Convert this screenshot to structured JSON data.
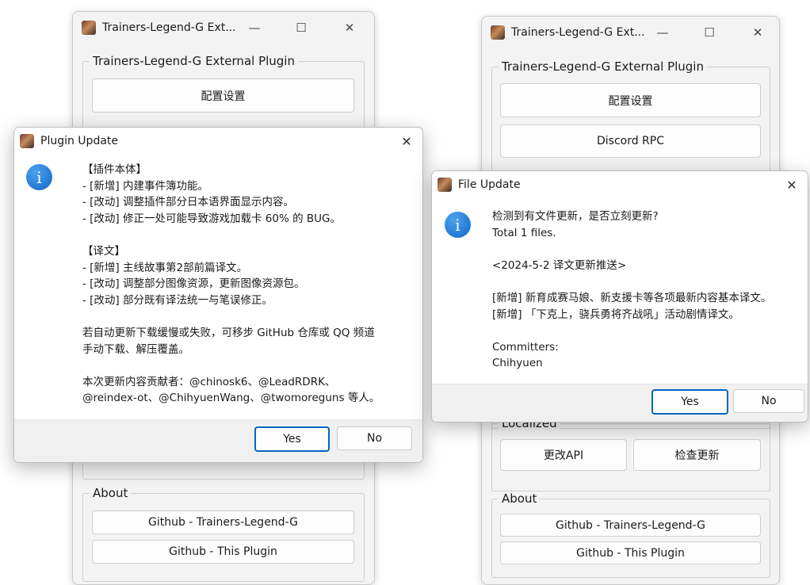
{
  "left_window": {
    "title": "Trainers-Legend-G Ext...",
    "controls": {
      "minimize": "—",
      "maximize": "☐",
      "close": "✕"
    },
    "group_title": "Trainers-Legend-G External Plugin",
    "config_button": "配置设置",
    "about_label": "About",
    "github_tlg": "Github - Trainers-Legend-G",
    "github_plugin": "Github - This Plugin"
  },
  "right_window": {
    "title": "Trainers-Legend-G Ext...",
    "controls": {
      "minimize": "—",
      "maximize": "☐",
      "close": "✕"
    },
    "group_title": "Trainers-Legend-G External Plugin",
    "config_button": "配置设置",
    "discord_button": "Discord RPC",
    "localized_label": "Localized",
    "change_api_button": "更改API",
    "check_update_button": "检查更新",
    "about_label": "About",
    "github_tlg": "Github - Trainers-Legend-G",
    "github_plugin": "Github - This Plugin"
  },
  "plugin_dialog": {
    "title": "Plugin Update",
    "close": "✕",
    "icon": "i",
    "lines": [
      "【插件本体】",
      "- [新增] 内建事件簿功能。",
      "- [改动] 调整插件部分日本语界面显示内容。",
      "- [改动] 修正一处可能导致游戏加载卡 60% 的 BUG。",
      "",
      "【译文】",
      "- [新增] 主线故事第2部前篇译文。",
      "- [改动] 调整部分图像资源，更新图像资源包。",
      "- [改动] 部分既有译法统一与笔误修正。",
      "",
      "若自动更新下载缓慢或失败，可移步 GitHub 仓库或 QQ 频道",
      "手动下载、解压覆盖。",
      "",
      "本次更新内容贡献者：@chinosk6、@LeadRDRK、",
      "@reindex-ot、@ChihyuenWang、@twomoreguns 等人。"
    ],
    "yes": "Yes",
    "no": "No"
  },
  "file_dialog": {
    "title": "File Update",
    "close": "✕",
    "icon": "i",
    "lines": [
      "检测到有文件更新，是否立刻更新?",
      "Total 1 files.",
      "",
      "<2024-5-2 译文更新推送>",
      "",
      "[新增] 新育成赛马娘、新支援卡等各项最新内容基本译文。",
      "[新增] 「下克上，骁兵勇将齐战吼」活动剧情译文。",
      "",
      "Committers:",
      "Chihyuen"
    ],
    "yes": "Yes",
    "no": "No"
  }
}
